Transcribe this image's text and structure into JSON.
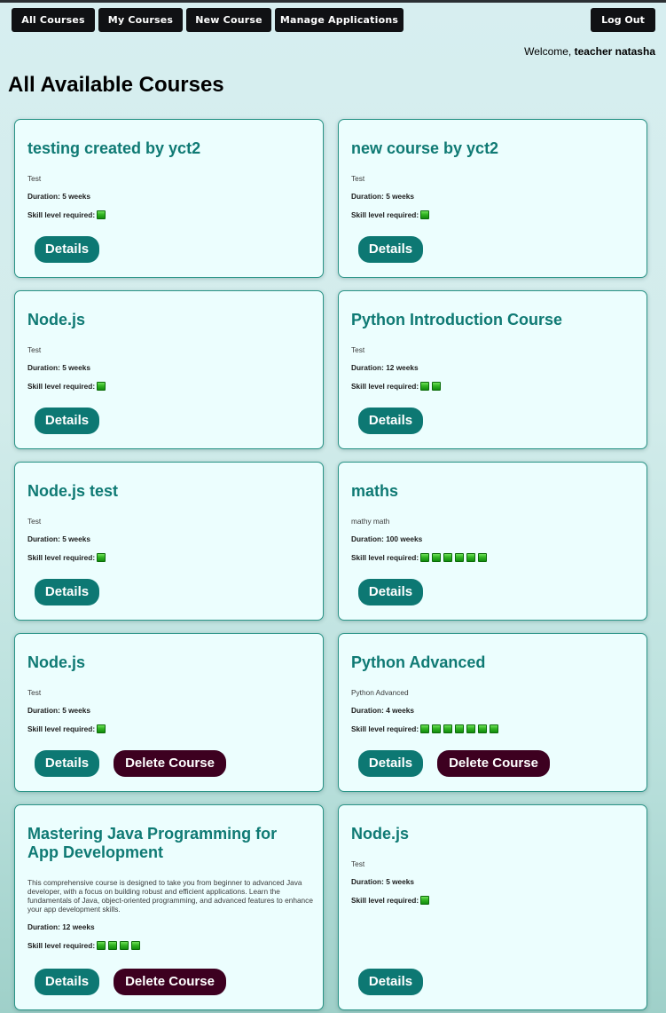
{
  "nav": {
    "all_courses": "All Courses",
    "my_courses": "My Courses",
    "new_course": "New Course",
    "manage_applications": "Manage Applications",
    "logout": "Log Out"
  },
  "welcome": {
    "prefix": "Welcome,",
    "username": "teacher natasha"
  },
  "page_title": "All Available Courses",
  "labels": {
    "duration_prefix": "Duration:",
    "skill_prefix": "Skill level required:",
    "details_button": "Details",
    "delete_button": "Delete Course"
  },
  "courses": [
    {
      "title": "testing created by yct2",
      "description": "Test",
      "duration": "5 weeks",
      "skill_level": 1,
      "can_delete": false
    },
    {
      "title": "new course by yct2",
      "description": "Test",
      "duration": "5 weeks",
      "skill_level": 1,
      "can_delete": false
    },
    {
      "title": "Node.js",
      "description": "Test",
      "duration": "5 weeks",
      "skill_level": 1,
      "can_delete": false
    },
    {
      "title": "Python Introduction Course",
      "description": "Test",
      "duration": "12 weeks",
      "skill_level": 2,
      "can_delete": false
    },
    {
      "title": "Node.js test",
      "description": "Test",
      "duration": "5 weeks",
      "skill_level": 1,
      "can_delete": false
    },
    {
      "title": "maths",
      "description": "mathy math",
      "duration": "100 weeks",
      "skill_level": 6,
      "can_delete": false
    },
    {
      "title": "Node.js",
      "description": "Test",
      "duration": "5 weeks",
      "skill_level": 1,
      "can_delete": true
    },
    {
      "title": "Python Advanced",
      "description": "Python Advanced",
      "duration": "4 weeks",
      "skill_level": 7,
      "can_delete": true
    },
    {
      "title": "Mastering Java Programming for App Development",
      "description": "This comprehensive course is designed to take you from beginner to advanced Java developer, with a focus on building robust and efficient applications. Learn the fundamentals of Java, object-oriented programming, and advanced features to enhance your app development skills.",
      "duration": "12 weeks",
      "skill_level": 4,
      "can_delete": true
    },
    {
      "title": "Node.js",
      "description": "Test",
      "duration": "5 weeks",
      "skill_level": 1,
      "can_delete": false
    }
  ],
  "colors": {
    "nav_button_bg": "#101114",
    "title_teal": "#0f7a74",
    "details_button_bg": "#0d7873",
    "delete_button_bg": "#3d0020",
    "card_bg": "#ecfefe",
    "card_border": "#2a9487"
  },
  "icons": {
    "skill_unit": "green-block-icon"
  }
}
